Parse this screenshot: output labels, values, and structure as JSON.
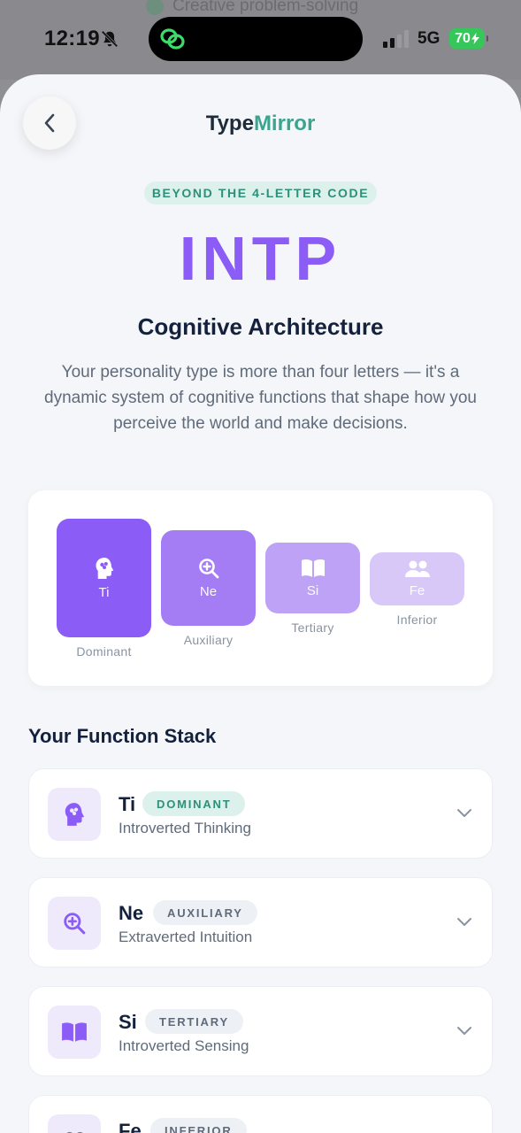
{
  "background": {
    "peek_text": "Creative problem-solving"
  },
  "status_bar": {
    "time": "12:19",
    "network": "5G",
    "battery": "70"
  },
  "header": {
    "brand_part1": "Type",
    "brand_part2": "Mirror"
  },
  "hero": {
    "eyebrow": "BEYOND THE 4-LETTER CODE",
    "type_code": "INTP",
    "subtitle": "Cognitive Architecture",
    "description": "Your personality type is more than four letters — it's a dynamic system of cognitive functions that shape how you perceive the world and make decisions."
  },
  "stack_visual": [
    {
      "abbr": "Ti",
      "caption": "Dominant",
      "icon": "brain-head-icon",
      "color": "#8b5cf6"
    },
    {
      "abbr": "Ne",
      "caption": "Auxiliary",
      "icon": "magnify-plus-icon",
      "color": "#a47df5"
    },
    {
      "abbr": "Si",
      "caption": "Tertiary",
      "icon": "book-open-icon",
      "color": "#bea2f6"
    },
    {
      "abbr": "Fe",
      "caption": "Inferior",
      "icon": "users-icon",
      "color": "#d8c8f8"
    }
  ],
  "function_stack": {
    "title": "Your Function Stack",
    "items": [
      {
        "abbr": "Ti",
        "badge": "DOMINANT",
        "full_name": "Introverted Thinking",
        "icon": "brain-head-icon"
      },
      {
        "abbr": "Ne",
        "badge": "AUXILIARY",
        "full_name": "Extraverted Intuition",
        "icon": "magnify-plus-icon"
      },
      {
        "abbr": "Si",
        "badge": "TERTIARY",
        "full_name": "Introverted Sensing",
        "icon": "book-open-icon"
      },
      {
        "abbr": "Fe",
        "badge": "INFERIOR",
        "full_name": "",
        "icon": "users-icon"
      }
    ]
  },
  "colors": {
    "accent": "#8b5cf6",
    "brand_teal": "#3aa58f",
    "heading": "#14213d",
    "muted": "#5f6b7a"
  }
}
